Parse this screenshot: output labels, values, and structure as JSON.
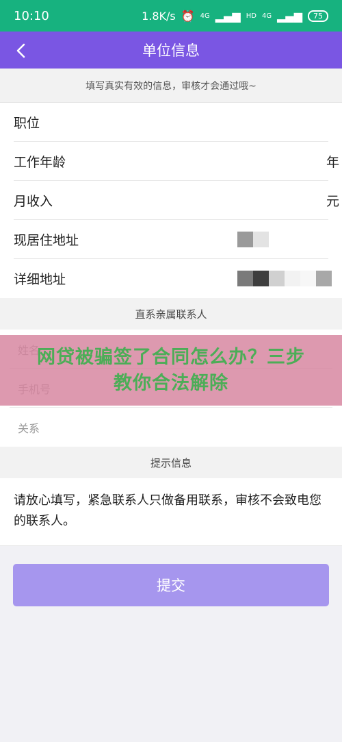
{
  "status_bar": {
    "time": "10:10",
    "speed": "1.8K/s",
    "net_label_1": "4G",
    "net_label_2": "HD",
    "net_label_3": "4G",
    "battery": "75"
  },
  "header": {
    "title": "单位信息"
  },
  "notice": "填写真实有效的信息，审核才会通过哦~",
  "form": {
    "position_label": "职位",
    "work_years_label": "工作年龄",
    "work_years_unit": "年",
    "income_label": "月收入",
    "income_unit": "元",
    "current_address_label": "现居住地址",
    "detail_address_label": "详细地址"
  },
  "contacts": {
    "title": "直系亲属联系人",
    "name_placeholder": "姓名",
    "phone_placeholder": "手机号",
    "relation_placeholder": "关系"
  },
  "overlay": {
    "text": "网贷被骗签了合同怎么办？三步教你合法解除"
  },
  "tips": {
    "title": "提示信息",
    "content": "请放心填写，紧急联系人只做备用联系，审核不会致电您的联系人。"
  },
  "submit_label": "提交",
  "colors": {
    "status_bar": "#17b27f",
    "header": "#7a56e3",
    "submit": "#a696ee",
    "overlay_text": "#4cad57"
  }
}
